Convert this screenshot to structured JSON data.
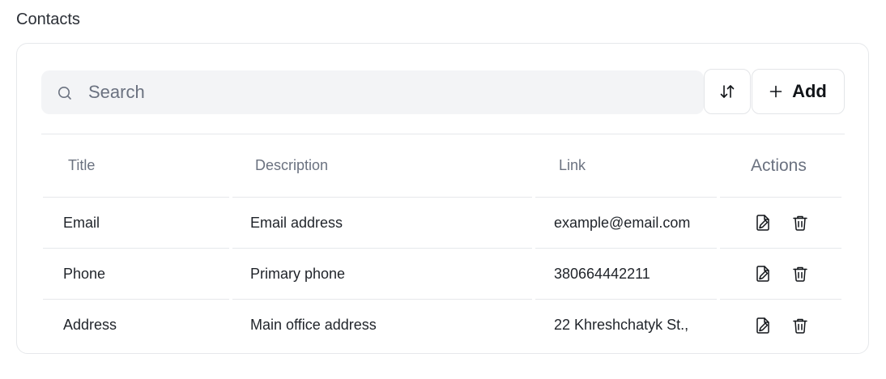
{
  "page": {
    "title": "Contacts"
  },
  "toolbar": {
    "search_placeholder": "Search",
    "search_value": "",
    "sort_icon": "sort-arrows-icon",
    "add_label": "Add",
    "add_icon": "plus-icon"
  },
  "table": {
    "columns": [
      "Title",
      "Description",
      "Link",
      "Actions"
    ],
    "rows": [
      {
        "title": "Email",
        "description": "Email address",
        "link": "example@email.com"
      },
      {
        "title": "Phone",
        "description": "Primary phone",
        "link": "380664442211"
      },
      {
        "title": "Address",
        "description": "Main office address",
        "link": "22 Khreshchatyk St.,"
      }
    ],
    "row_actions": [
      "edit-icon",
      "trash-icon"
    ]
  }
}
